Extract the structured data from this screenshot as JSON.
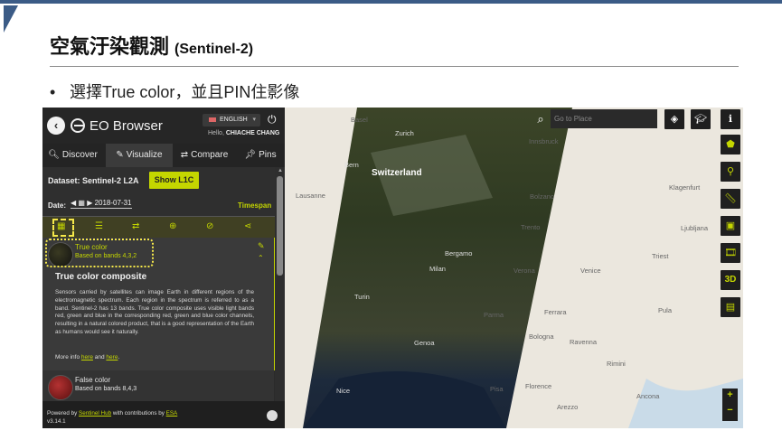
{
  "slide": {
    "title": "空氣汙染觀測",
    "title_suffix": "(Sentinel-2)",
    "bullet": "選擇True color，並且PIN住影像"
  },
  "panel": {
    "brand": "EO Browser",
    "language": "ENGLISH",
    "hello_prefix": "Hello,",
    "user": "CHIACHE CHANG",
    "tabs": [
      {
        "icon": "search-icon",
        "label": "Discover"
      },
      {
        "icon": "brush-icon",
        "label": "Visualize"
      },
      {
        "icon": "compare-icon",
        "label": "Compare"
      },
      {
        "icon": "pin-icon",
        "label": "Pins"
      }
    ],
    "dataset_label": "Dataset: Sentinel-2 L2A",
    "show_l1c": "Show L1C",
    "date_label": "Date:",
    "date_value": "2018-07-31",
    "timespan": "Timespan",
    "layers": [
      {
        "title": "True color",
        "bands": "Based on bands 4,3,2"
      },
      {
        "title": "False color",
        "bands": "Based on bands 8,4,3"
      }
    ],
    "composite_title": "True color composite",
    "composite_desc": "Sensors carried by satellites can image Earth in different regions of the electromagnetic spectrum. Each region in the spectrum is referred to as a band. Sentinel-2 has 13 bands. True color composite uses visible light bands red, green and blue in the corresponding red, green and blue color channels, resulting in a natural colored product, that is a good representation of the Earth as humans would see it naturally.",
    "more_info_prefix": "More info",
    "more_info_link1": "here",
    "more_info_and": "and",
    "more_info_link2": "here",
    "more_info_suffix": ".",
    "footer_prefix": "Powered by",
    "footer_link1": "Sentinel Hub",
    "footer_mid": "with contributions by",
    "footer_link2": "ESA",
    "version": "v3.14.1"
  },
  "map": {
    "search_placeholder": "Go to Place",
    "cities": {
      "basel": "Basel",
      "zurich": "Zurich",
      "innsbruck": "Innsbruck",
      "bern": "Bern",
      "switzerland": "Switzerland",
      "klagenfurt": "Klagenfurt",
      "lausanne": "Lausanne",
      "bolzano": "Bolzano",
      "trento": "Trento",
      "ljubljana": "Ljubljana",
      "trieste": "Triest",
      "bergamo": "Bergamo",
      "milan": "Milan",
      "verona": "Verona",
      "venice": "Venice",
      "turin": "Turin",
      "parma": "Parma",
      "ferrara": "Ferrara",
      "pula": "Pula",
      "bologna": "Bologna",
      "ravenna": "Ravenna",
      "genoa": "Genoa",
      "rimini": "Rimini",
      "nice": "Nice",
      "pisa": "Pisa",
      "florence": "Florence",
      "ancona": "Ancona",
      "arezzo": "Arezzo"
    },
    "btn_3d": "3D"
  }
}
